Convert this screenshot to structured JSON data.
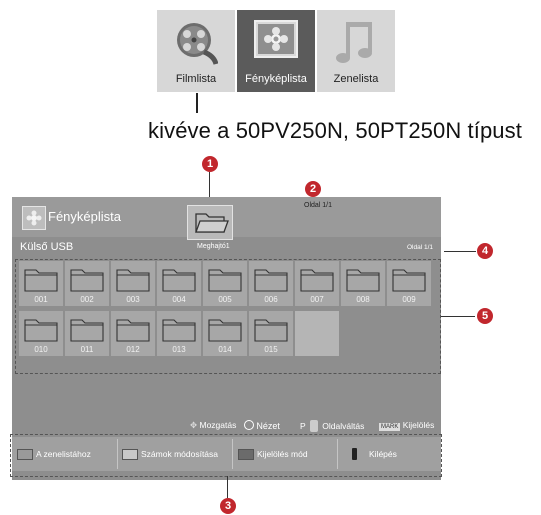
{
  "tiles": [
    {
      "label": "Filmlista",
      "icon": "film-reel-icon",
      "selected": false
    },
    {
      "label": "Fényképlista",
      "icon": "flower-photo-icon",
      "selected": true
    },
    {
      "label": "Zenelista",
      "icon": "music-note-icon",
      "selected": false
    }
  ],
  "caption": "kivéve a 50PV250N, 50PT250N típust",
  "screen": {
    "title": "Fényképlista",
    "drive_label": "Meghajtó1",
    "page_top": "Oldal 1/1",
    "device": "Külső USB",
    "page_right": "Oldal 1/1",
    "folders": [
      "001",
      "002",
      "003",
      "004",
      "005",
      "006",
      "007",
      "008",
      "009",
      "010",
      "011",
      "012",
      "013",
      "014",
      "015"
    ],
    "hints": {
      "move": "Mozgatás",
      "view": "Nézet",
      "p": "P",
      "page_switch": "Oldalváltás",
      "mark_key": "MARK",
      "select": "Kijelölés"
    },
    "buttons": [
      {
        "label": "A zenelistához",
        "color": "#9a9a9a"
      },
      {
        "label": "Számok módosítása",
        "color": "#c8c8c8"
      },
      {
        "label": "Kijelölés mód",
        "color": "#6b6b6b"
      },
      {
        "label": "Kilépés",
        "color": "#222222"
      }
    ]
  },
  "markers": [
    "1",
    "2",
    "3",
    "4",
    "5"
  ]
}
